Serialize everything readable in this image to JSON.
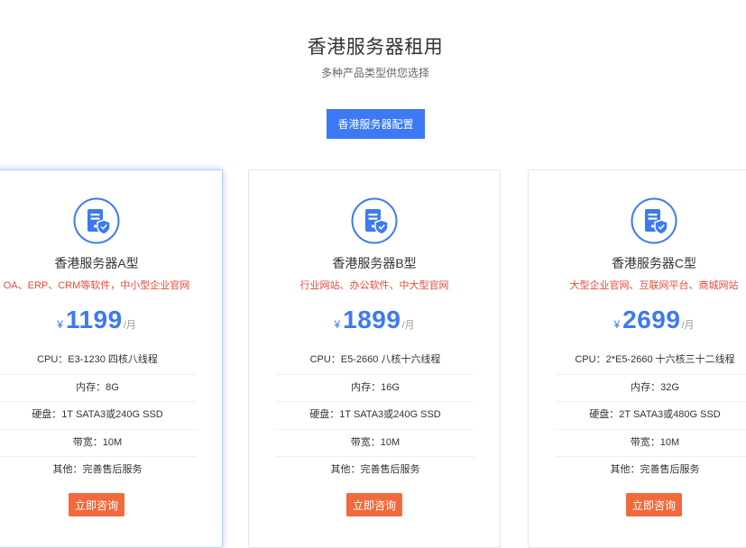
{
  "header": {
    "title": "香港服务器租用",
    "subtitle": "多种产品类型供您选择",
    "config_button_label": "香港服务器配置"
  },
  "colors": {
    "accent": "#3b79f5",
    "description_red": "#e8493b",
    "button_orange": "#f06a3d"
  },
  "plans": [
    {
      "name": "香港服务器A型",
      "description": "OA、ERP、CRM等软件，中小型企业官网",
      "currency": "¥",
      "price": "1199",
      "unit": "/月",
      "specs": [
        "CPU：E3-1230 四核八线程",
        "内存：8G",
        "硬盘：1T SATA3或240G SSD",
        "带宽：10M",
        "其他：完善售后服务"
      ],
      "button_label": "立即咨询",
      "icon": "server-shield-icon"
    },
    {
      "name": "香港服务器B型",
      "description": "行业网站、办公软件、中大型官网",
      "currency": "¥",
      "price": "1899",
      "unit": "/月",
      "specs": [
        "CPU：E5-2660 八核十六线程",
        "内存：16G",
        "硬盘：1T SATA3或240G SSD",
        "带宽：10M",
        "其他：完善售后服务"
      ],
      "button_label": "立即咨询",
      "icon": "server-shield-icon"
    },
    {
      "name": "香港服务器C型",
      "description": "大型企业官网、互联网平台、商城网站",
      "currency": "¥",
      "price": "2699",
      "unit": "/月",
      "specs": [
        "CPU：2*E5-2660 十六核三十二线程",
        "内存：32G",
        "硬盘：2T SATA3或480G SSD",
        "带宽：10M",
        "其他：完善售后服务"
      ],
      "button_label": "立即咨询",
      "icon": "server-shield-icon"
    }
  ]
}
